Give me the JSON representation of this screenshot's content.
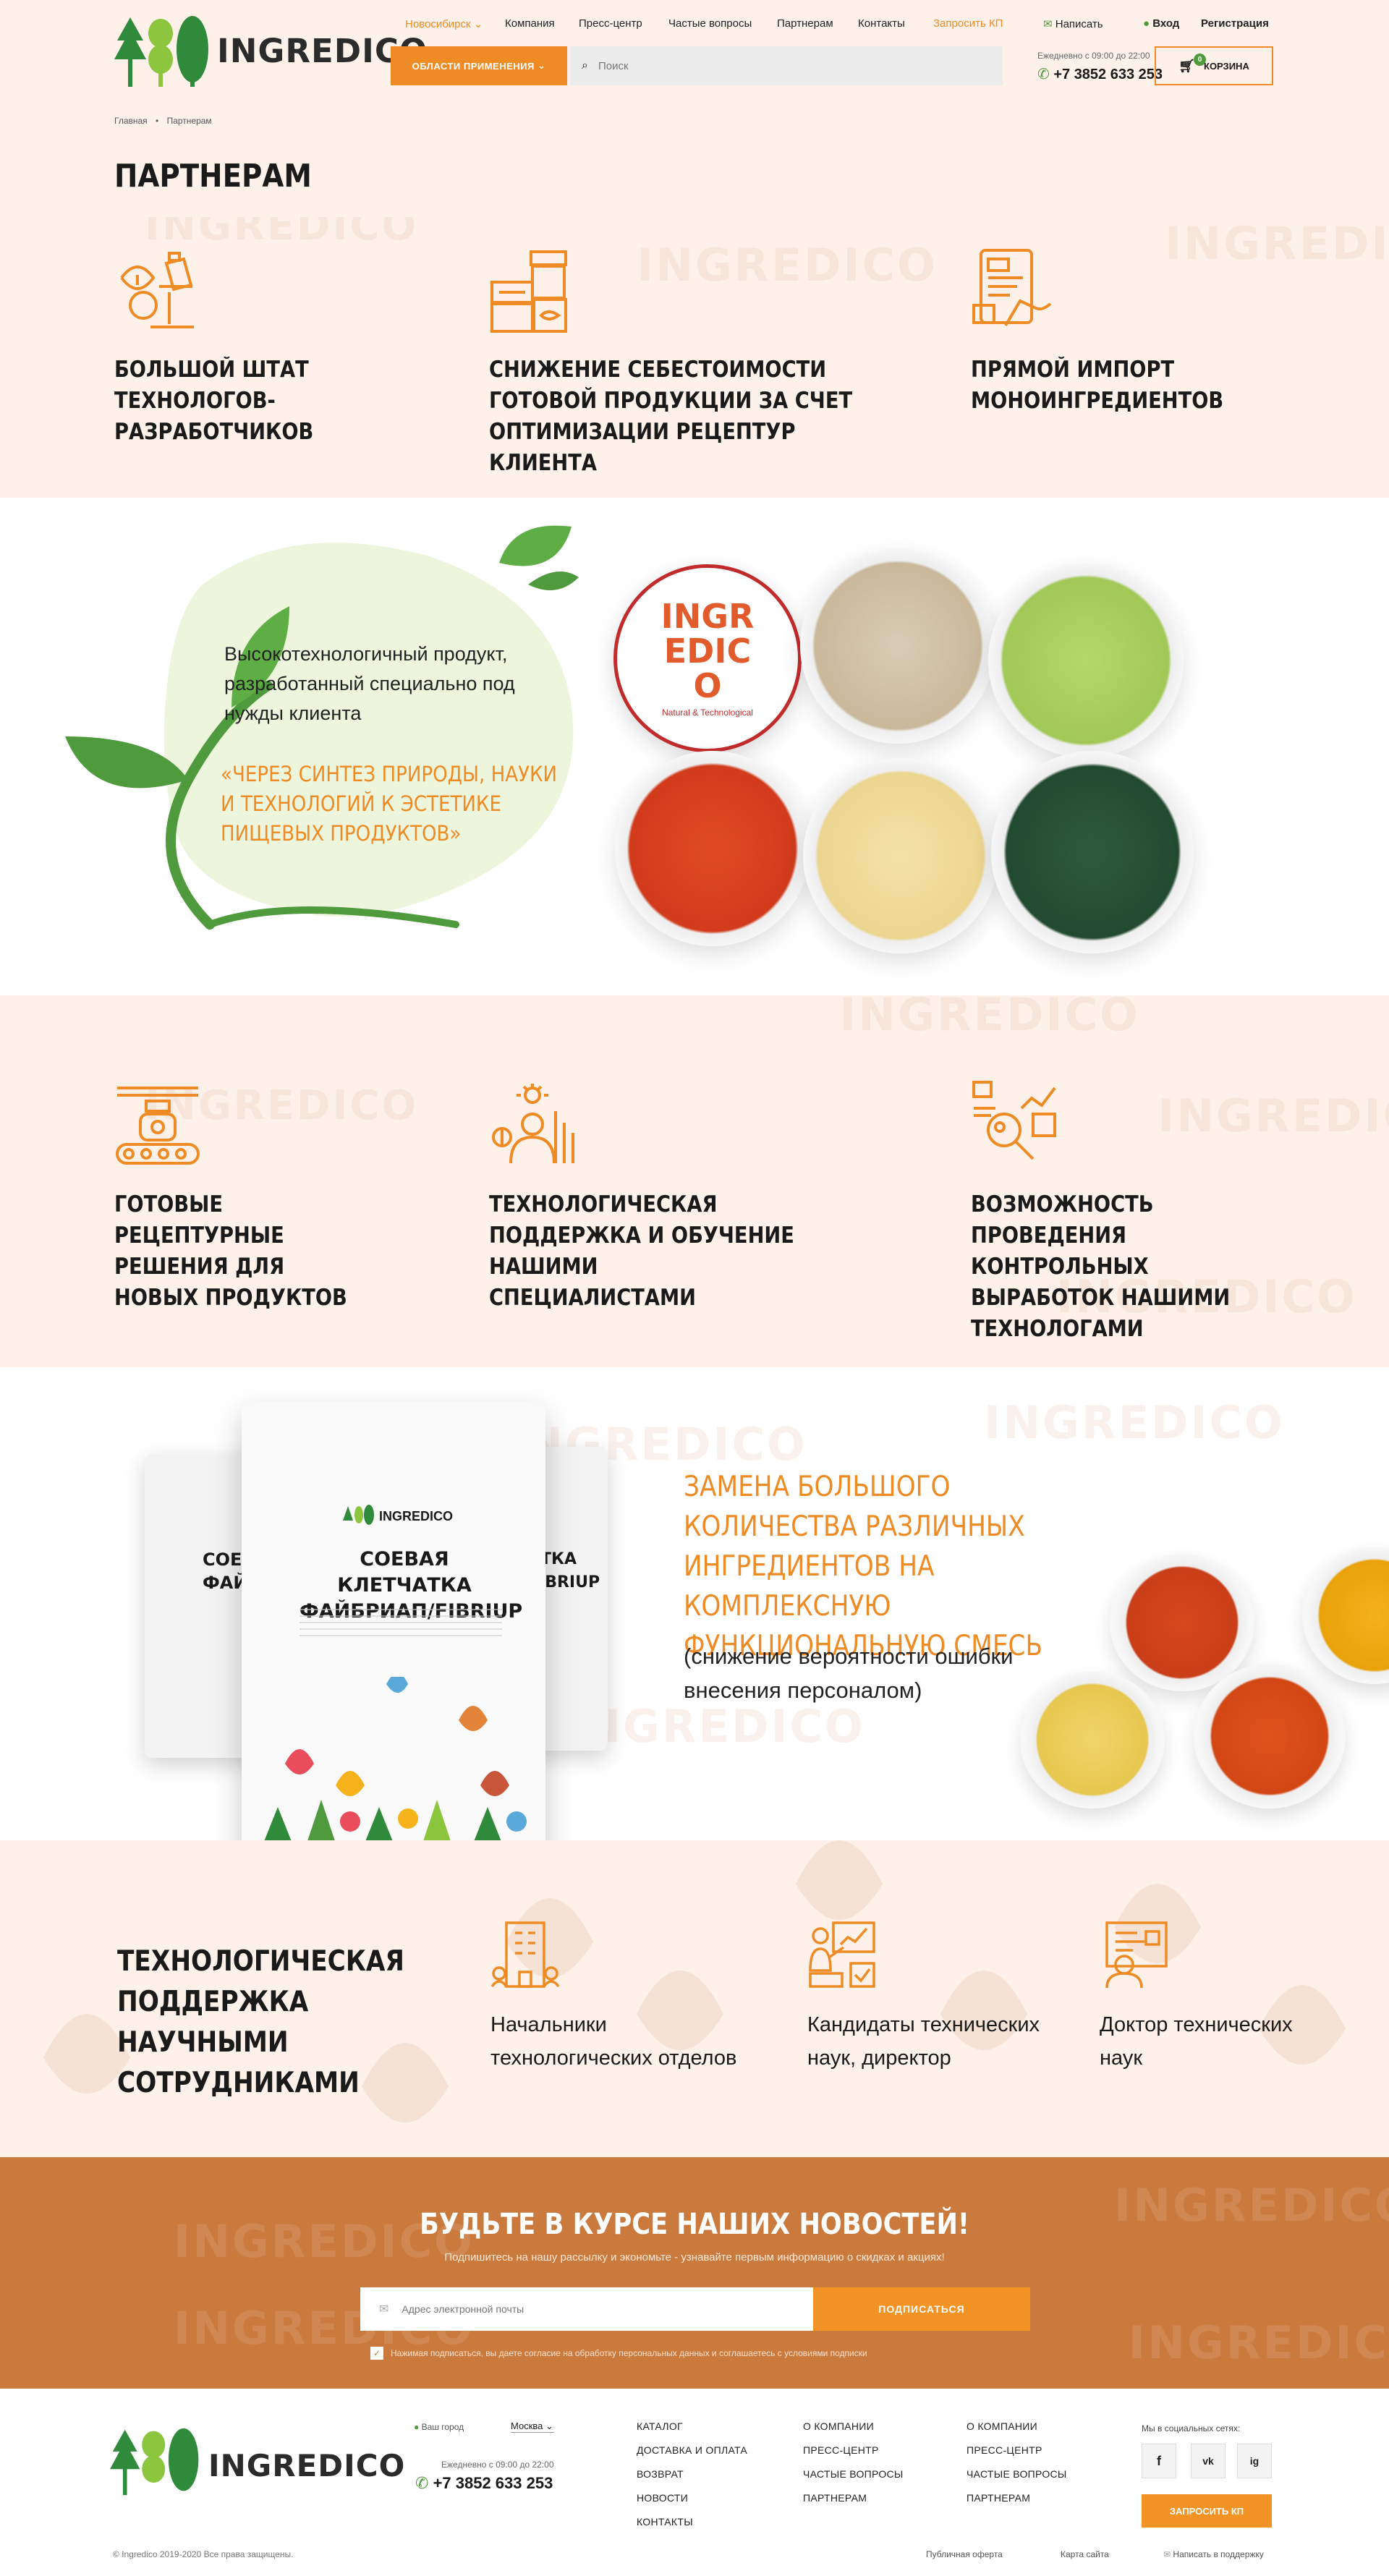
{
  "header": {
    "logo_text": "INGREDICO",
    "city": "Новосибирск",
    "nav": [
      "Компания",
      "Пресс-центр",
      "Частые вопросы",
      "Партнерам",
      "Контакты"
    ],
    "request_quote": "Запросить КП",
    "write": "Написать",
    "login": "Вход",
    "register": "Регистрация",
    "areas_button": "ОБЛАСТИ ПРИМЕНЕНИЯ",
    "search_placeholder": "Поиск",
    "hours": "Ежедневно с 09:00 до 22:00",
    "phone": "+7 3852 633 253",
    "cart_label": "КОРЗИНА",
    "cart_count": "0"
  },
  "breadcrumb": {
    "home": "Главная",
    "current": "Партнерам"
  },
  "page_title": "ПАРТНЕРАМ",
  "features_1": [
    {
      "title": "БОЛЬШОЙ ШТАТ ТЕХНОЛОГОВ-РАЗРАБОТЧИКОВ",
      "icon": "microscope-icon"
    },
    {
      "title": "СНИЖЕНИЕ СЕБЕСТОИМОСТИ ГОТОВОЙ ПРОДУКЦИИ ЗА СЧЕТ ОПТИМИЗАЦИИ РЕЦЕПТУР КЛИЕНТА",
      "icon": "cans-icon"
    },
    {
      "title": "ПРЯМОЙ ИМПОРТ МОНОИНГРЕДИЕНТОВ",
      "icon": "tablet-order-icon"
    }
  ],
  "promo": {
    "text": "Высокотехнологичный продукт, разработанный специально под нужды клиента",
    "quote": "«ЧЕРЕЗ СИНТЕЗ ПРИРОДЫ, НАУКИ И ТЕХНОЛОГИЙ К ЭСТЕТИКЕ ПИЩЕВЫХ ПРОДУКТОВ»",
    "badge_text": "INGREDICO",
    "badge_sub": "Natural & Technological"
  },
  "features_2": [
    {
      "title": "ГОТОВЫЕ РЕЦЕПТУРНЫЕ РЕШЕНИЯ ДЛЯ НОВЫХ ПРОДУКТОВ",
      "icon": "conveyor-icon"
    },
    {
      "title": "ТЕХНОЛОГИЧЕСКАЯ ПОДДЕРЖКА И ОБУЧЕНИЕ НАШИМИ СПЕЦИАЛИСТАМИ",
      "icon": "specialist-icon"
    },
    {
      "title": "ВОЗМОЖНОСТЬ ПРОВЕДЕНИЯ КОНТРОЛЬНЫХ ВЫРАБОТОК НАШИМИ ТЕХНОЛОГАМИ",
      "icon": "analytics-icon"
    }
  ],
  "mix": {
    "title": "ЗАМЕНА БОЛЬШОГО КОЛИЧЕСТВА РАЗЛИЧНЫХ ИНГРЕДИЕНТОВ НА КОМПЛЕКСНУЮ ФУНКЦИОНАЛЬНУЮ СМЕСЬ",
    "note": "(снижение вероятности ошибки внесения персоналом)",
    "pack_brand": "INGREDICO",
    "pack_title": "СОЕВАЯ КЛЕТЧАТКА ФАЙБРИАП/FIBRIUP",
    "pack_side_left": "СОЕВА ФАЙБР",
    "pack_side_right": "АТКА FIBRIUP"
  },
  "science": {
    "title": "ТЕХНОЛОГИЧЕСКАЯ ПОДДЕРЖКА НАУЧНЫМИ СОТРУДНИКАМИ",
    "items": [
      {
        "label": "Начальники технологических отделов",
        "icon": "building-icon"
      },
      {
        "label": "Кандидаты технических наук, директор",
        "icon": "presentation-icon"
      },
      {
        "label": "Доктор технических наук",
        "icon": "doctor-icon"
      }
    ]
  },
  "newsletter": {
    "title": "БУДЬТЕ В КУРСЕ НАШИХ НОВОСТЕЙ!",
    "subtitle": "Подпишитесь на нашу рассылку и экономьте - узнавайте первым информацию о скидках и акциях!",
    "placeholder": "Адрес электронной почты",
    "button": "ПОДПИСАТЬСЯ",
    "consent": "Нажимая подписаться, вы даете согласие на обработку персональных данных и соглашаетесь с условиями подписки"
  },
  "footer": {
    "logo_text": "INGREDICO",
    "city_label": "Ваш город",
    "city": "Москва",
    "hours": "Ежедневно с 09:00 до 22:00",
    "phone": "+7 3852 633 253",
    "col1": [
      "КАТАЛОГ",
      "ДОСТАВКА И ОПЛАТА",
      "ВОЗВРАТ",
      "НОВОСТИ",
      "КОНТАКТЫ"
    ],
    "col2": [
      "О КОМПАНИИ",
      "ПРЕСС-ЦЕНТР",
      "ЧАСТЫЕ ВОПРОСЫ",
      "ПАРТНЕРАМ"
    ],
    "col3": [
      "О КОМПАНИИ",
      "ПРЕСС-ЦЕНТР",
      "ЧАСТЫЕ ВОПРОСЫ",
      "ПАРТНЕРАМ"
    ],
    "social_label": "Мы в социальных сетях:",
    "social": [
      "f",
      "vk",
      "ig"
    ],
    "request_button": "ЗАПРОСИТЬ КП",
    "copyright": "© Ingredico 2019-2020 Все права защищены.",
    "offer": "Публичная оферта",
    "sitemap": "Карта сайта",
    "support": "Написать в поддержку"
  },
  "colors": {
    "accent": "#ef8b25",
    "green": "#4e9a3c",
    "newsletter_bg": "#cb7a3e",
    "bg": "#fdf1ea"
  }
}
